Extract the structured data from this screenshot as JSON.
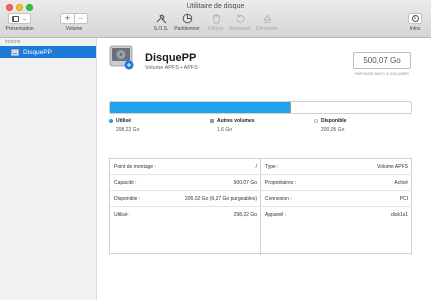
{
  "window": {
    "title": "Utilitaire de disque"
  },
  "toolbar": {
    "presentation_label": "Présentation",
    "volume_label": "Volume",
    "sos_label": "S.O.S.",
    "partition_label": "Partitionner",
    "erase_label": "Effacer",
    "restore_label": "Restaurer",
    "unmount_label": "Démonter",
    "info_label": "Infos"
  },
  "sidebar": {
    "section_header": "Interne",
    "items": [
      {
        "label": "DisquePP",
        "selected": true
      }
    ]
  },
  "disk": {
    "name": "DisquePP",
    "subtitle": "Volume APFS • APFS",
    "capacity": "500,07 Go",
    "shared_note": "PARTAGÉ AVEC 4 VOLUMES"
  },
  "usage": {
    "segments": [
      {
        "name": "Utilisé",
        "value": "298,22 Go",
        "color": "#21a4ee",
        "fraction": 0.5964
      },
      {
        "name": "Autres volumes",
        "value": "1,6 Go",
        "color": "#9a9a9a",
        "fraction": 0.0032
      },
      {
        "name": "Disponible",
        "value": "200,05 Go",
        "color": "#ffffff",
        "fraction": 0.4004
      }
    ]
  },
  "info_left": [
    {
      "label": "Point de montage :",
      "value": "/"
    },
    {
      "label": "Capacité :",
      "value": "500,07 Go"
    },
    {
      "label": "Disponible :",
      "value": "206,32 Go (6,27 Go purgeables)"
    },
    {
      "label": "Utilisé :",
      "value": "298,22 Go"
    }
  ],
  "info_right": [
    {
      "label": "Type :",
      "value": "Volume APFS"
    },
    {
      "label": "Propriétaires :",
      "value": "Activé"
    },
    {
      "label": "Connexion :",
      "value": "PCI"
    },
    {
      "label": "Appareil :",
      "value": "disk1s1"
    }
  ]
}
